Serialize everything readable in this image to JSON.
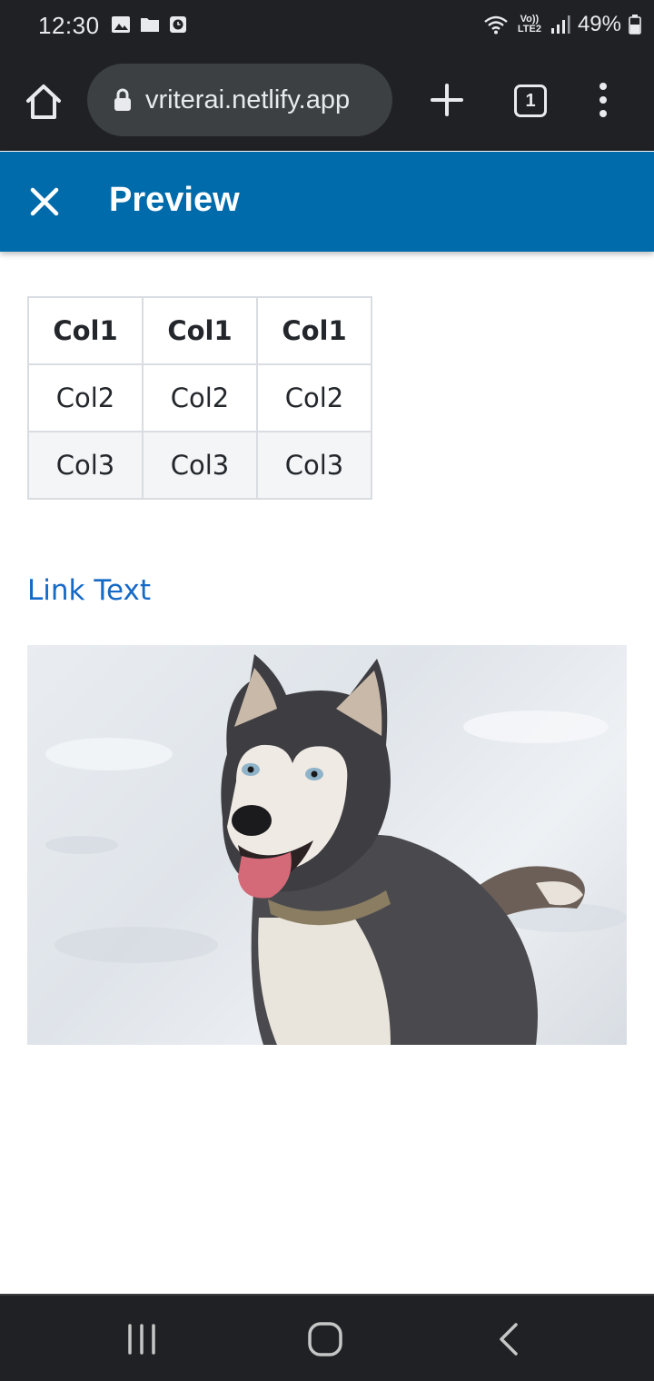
{
  "status_bar": {
    "time": "12:30",
    "network_label": "Vo)) LTE2",
    "battery": "49%",
    "icons": [
      "gallery-icon",
      "folder-icon",
      "clock-icon",
      "wifi-icon",
      "signal-icon",
      "battery-icon"
    ]
  },
  "browser": {
    "url": "vriterai.netlify.app",
    "tab_count": "1"
  },
  "header": {
    "title": "Preview",
    "color": "#006bab"
  },
  "table": {
    "headers": [
      "Col1",
      "Col1",
      "Col1"
    ],
    "rows": [
      [
        "Col2",
        "Col2",
        "Col2"
      ],
      [
        "Col3",
        "Col3",
        "Col3"
      ]
    ]
  },
  "link": {
    "text": "Link Text",
    "color": "#1569c7"
  },
  "image": {
    "subject": "husky-in-snow"
  }
}
